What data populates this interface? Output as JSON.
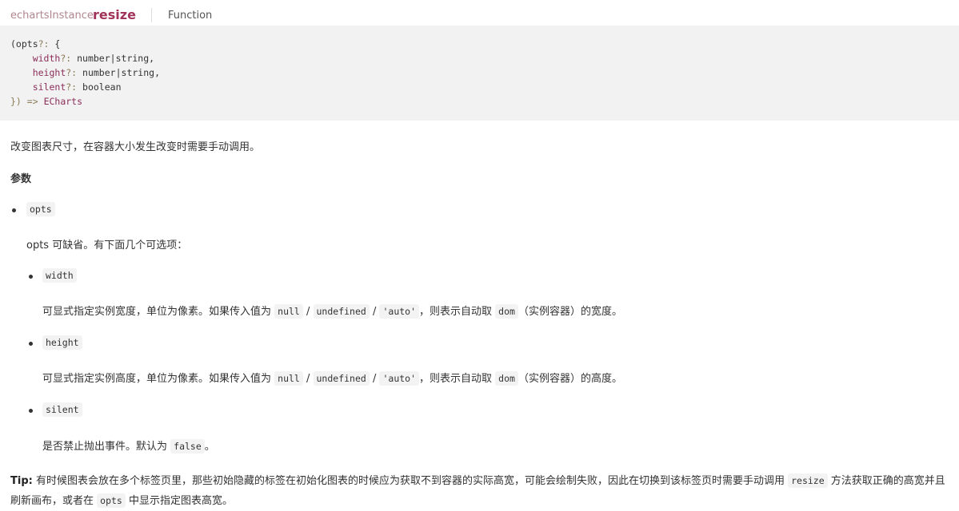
{
  "header": {
    "prefix": "echartsInstance.",
    "name": "resize",
    "kind": "Function"
  },
  "signature": {
    "open": "(opts",
    "q": "?:",
    "brace": " {",
    "lines": [
      {
        "key": "width",
        "q": "?:",
        "type": " number",
        "pipe": "|",
        "type2": "string",
        "end": ","
      },
      {
        "key": "height",
        "q": "?:",
        "type": " number",
        "pipe": "|",
        "type2": "string",
        "end": ","
      },
      {
        "key": "silent",
        "q": "?:",
        "type": " boolean",
        "pipe": "",
        "type2": "",
        "end": ""
      }
    ],
    "close": "})",
    "arrow": " => ",
    "ret": "ECharts"
  },
  "description": "改变图表尺寸，在容器大小发生改变时需要手动调用。",
  "params_title": "参数",
  "opts": {
    "name": "opts",
    "desc": "opts 可缺省。有下面几个可选项："
  },
  "width_item": {
    "name": "width",
    "d1": "可显式指定实例宽度，单位为像素。如果传入值为 ",
    "c1": "null",
    "s1": " / ",
    "c2": "undefined",
    "s2": " / ",
    "c3": "'auto'",
    "d2": "，则表示自动取 ",
    "c4": "dom",
    "d3": "（实例容器）的宽度。"
  },
  "height_item": {
    "name": "height",
    "d1": "可显式指定实例高度，单位为像素。如果传入值为 ",
    "c1": "null",
    "s1": " / ",
    "c2": "undefined",
    "s2": " / ",
    "c3": "'auto'",
    "d2": "，则表示自动取 ",
    "c4": "dom",
    "d3": "（实例容器）的高度。"
  },
  "silent_item": {
    "name": "silent",
    "d1": "是否禁止抛出事件。默认为 ",
    "c1": "false",
    "d2": "。"
  },
  "tip": {
    "label": "Tip:",
    "p1": " 有时候图表会放在多个标签页里，那些初始隐藏的标签在初始化图表的时候应为获取不到容器的实际高宽，可能会绘制失败，因此在切换到该标签页时需要手动调用 ",
    "c1": "resize",
    "p2": " 方法获取正确的高宽并且刷新画布，或者在 ",
    "c2": "opts",
    "p3": " 中显示指定图表高宽。"
  }
}
